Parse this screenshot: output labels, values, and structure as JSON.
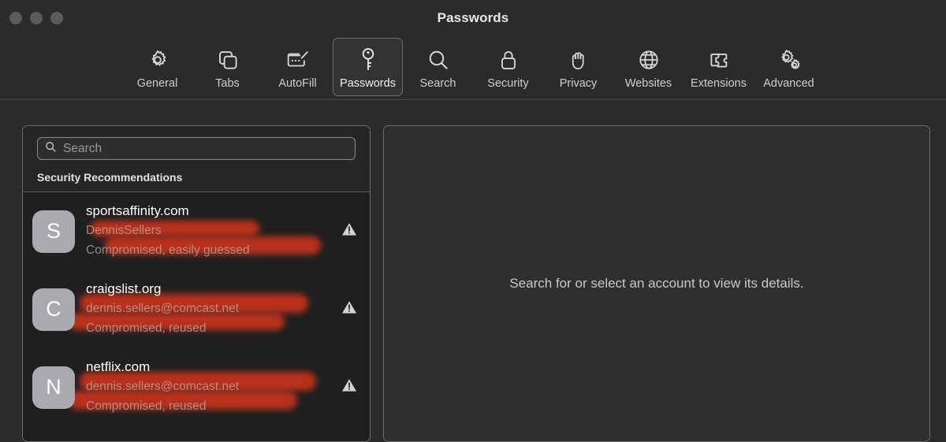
{
  "window": {
    "title": "Passwords",
    "traffic_lights": [
      "close-button",
      "minimize-button",
      "zoom-button"
    ]
  },
  "toolbar": {
    "items": [
      {
        "label": "General",
        "icon": "gear-icon",
        "selected": false
      },
      {
        "label": "Tabs",
        "icon": "tabs-icon",
        "selected": false
      },
      {
        "label": "AutoFill",
        "icon": "autofill-icon",
        "selected": false
      },
      {
        "label": "Passwords",
        "icon": "key-icon",
        "selected": true
      },
      {
        "label": "Search",
        "icon": "magnifier-icon",
        "selected": false
      },
      {
        "label": "Security",
        "icon": "lock-icon",
        "selected": false
      },
      {
        "label": "Privacy",
        "icon": "hand-icon",
        "selected": false
      },
      {
        "label": "Websites",
        "icon": "globe-icon",
        "selected": false
      },
      {
        "label": "Extensions",
        "icon": "puzzle-icon",
        "selected": false
      },
      {
        "label": "Advanced",
        "icon": "gears-icon",
        "selected": false
      }
    ]
  },
  "sidebar": {
    "search": {
      "value": "",
      "placeholder": "Search",
      "icon": "search-icon"
    },
    "section_header": "Security Recommendations",
    "entries": [
      {
        "initial": "S",
        "site": "sportsaffinity.com",
        "username": "DennisSellers",
        "status": "Compromised, easily guessed",
        "warning_icon": "warning-triangle-icon",
        "redacted": true
      },
      {
        "initial": "C",
        "site": "craigslist.org",
        "username": "dennis.sellers@comcast.net",
        "status": "Compromised, reused",
        "warning_icon": "warning-triangle-icon",
        "redacted": true
      },
      {
        "initial": "N",
        "site": "netflix.com",
        "username": "dennis.sellers@comcast.net",
        "status": "Compromised, reused",
        "warning_icon": "warning-triangle-icon",
        "redacted": true
      }
    ]
  },
  "detail": {
    "empty_message": "Search for or select an account to view its details."
  },
  "colors": {
    "window_background": "#2b2b2b",
    "panel_background": "#1f1f1f",
    "panel_border": "#6b6b6b",
    "detail_background": "#2f2f2f",
    "avatar_background": "#a9a9af",
    "redaction_marker": "#c3321c",
    "text_primary": "#ffffff",
    "text_secondary": "#b7b2ae",
    "selected_tab_border": "#6d6d6d"
  }
}
